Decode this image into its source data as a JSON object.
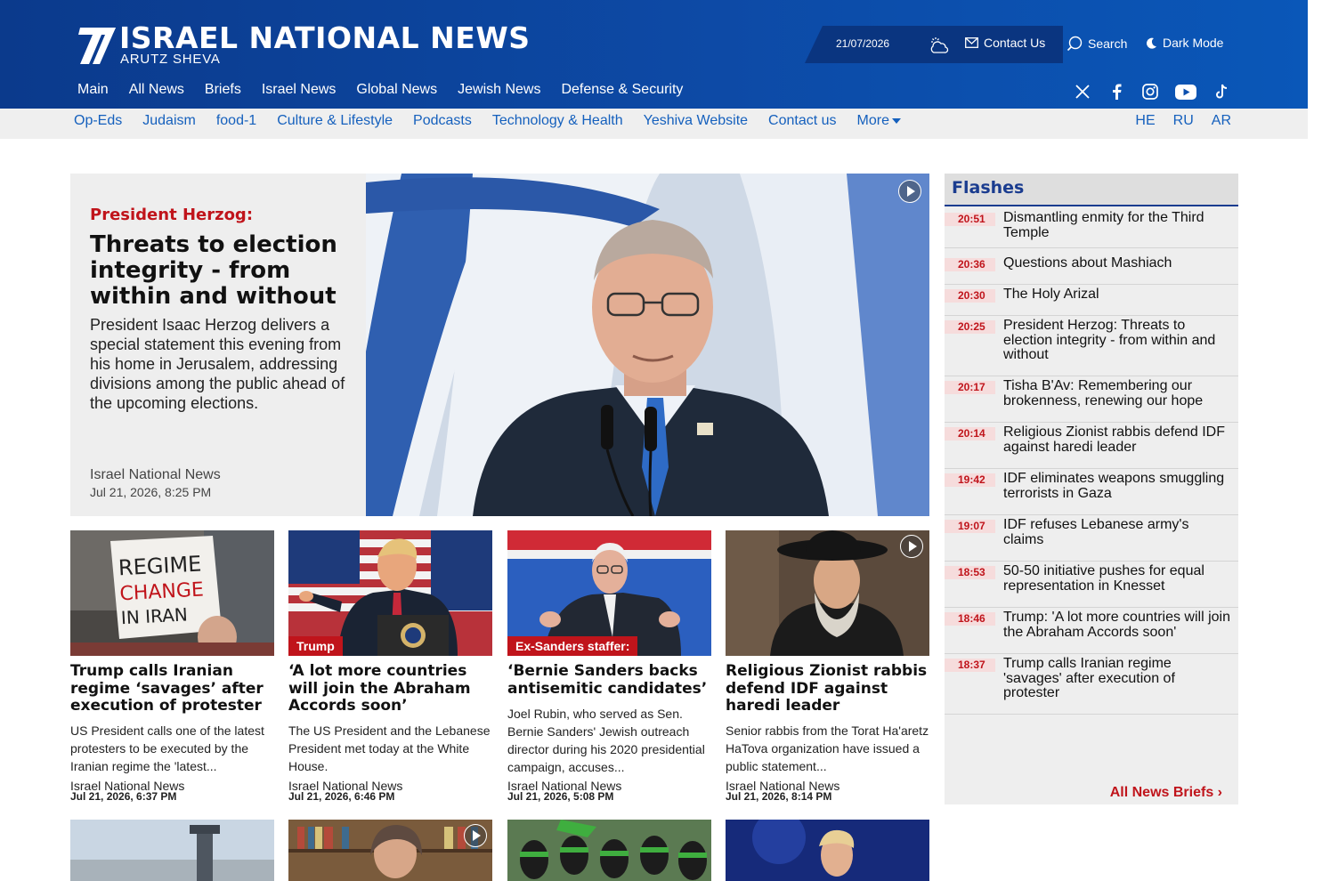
{
  "brand": {
    "title": "ISRAEL NATIONAL NEWS",
    "subtitle": "ARUTZ SHEVA"
  },
  "utility": {
    "date": "21/07/2026",
    "contact": "Contact Us",
    "search": "Search",
    "dark_mode": "Dark Mode"
  },
  "main_nav": [
    "Main",
    "All News",
    "Briefs",
    "Israel News",
    "Global News",
    "Jewish News",
    "Defense & Security"
  ],
  "sub_nav": [
    "Op-Eds",
    "Judaism",
    "food-1",
    "Culture & Lifestyle",
    "Podcasts",
    "Technology & Health",
    "Yeshiva Website",
    "Contact us",
    "More"
  ],
  "languages": [
    "HE",
    "RU",
    "AR"
  ],
  "social_icons": [
    "x-icon",
    "facebook-icon",
    "instagram-icon",
    "youtube-icon",
    "tiktok-icon"
  ],
  "hero": {
    "kicker": "President Herzog:",
    "headline": "Threats to election integrity - from within and without",
    "summary": "President Isaac Herzog delivers a special statement this evening from his home in Jerusalem, addressing divisions among the public ahead of the upcoming elections.",
    "author": "Israel National News",
    "date": "Jul 21, 2026, 8:25 PM"
  },
  "cards": [
    {
      "tag": "",
      "title": "Trump calls Iranian regime ‘savages’ after execution of protester",
      "summary": "US President calls one of the latest protesters to be executed by the Iranian regime the 'latest...",
      "author": "Israel National News",
      "date": "Jul 21, 2026, 6:37 PM"
    },
    {
      "tag": "Trump",
      "title": "‘A lot more countries will join the Abraham Accords soon’",
      "summary": "The US President and the Lebanese President met today at the White House.",
      "author": "Israel National News",
      "date": "Jul 21, 2026, 6:46 PM"
    },
    {
      "tag": "Ex-Sanders staffer:",
      "title": "‘Bernie Sanders backs antisemitic candidates’",
      "summary": "Joel Rubin, who served as Sen. Bernie Sanders' Jewish outreach director during his 2020 presidential campaign, accuses...",
      "author": "Israel National News",
      "date": "Jul 21, 2026, 5:08 PM"
    },
    {
      "tag": "",
      "title": "Religious Zionist rabbis defend IDF against haredi leader",
      "summary": "Senior rabbis from the Torat Ha'aretz HaTova organization have issued a public statement...",
      "author": "Israel National News",
      "date": "Jul 21, 2026, 8:14 PM"
    }
  ],
  "sign_text": {
    "line1": "REGIME",
    "line2": "CHANGE",
    "line3": "IN IRAN"
  },
  "flashes": {
    "title": "Flashes",
    "items": [
      {
        "time": "20:51",
        "text": "Dismantling enmity for the Third Temple"
      },
      {
        "time": "20:36",
        "text": "Questions about Mashiach"
      },
      {
        "time": "20:30",
        "text": "The Holy Arizal"
      },
      {
        "time": "20:25",
        "text": "President Herzog: Threats to election integrity - from within and without"
      },
      {
        "time": "20:17",
        "text": "Tisha B'Av: Remembering our brokenness, renewing our hope"
      },
      {
        "time": "20:14",
        "text": "Religious Zionist rabbis defend IDF against haredi leader"
      },
      {
        "time": "19:42",
        "text": "IDF eliminates weapons smuggling terrorists in Gaza"
      },
      {
        "time": "19:07",
        "text": "IDF refuses Lebanese army's claims"
      },
      {
        "time": "18:53",
        "text": "50-50 initiative pushes for equal representation in Knesset"
      },
      {
        "time": "18:46",
        "text": "Trump: 'A lot more countries will join the Abraham Accords soon'"
      },
      {
        "time": "18:37",
        "text": "Trump calls Iranian regime 'savages' after execution of protester"
      }
    ],
    "all_briefs": "All News Briefs ›"
  },
  "colors": {
    "header_blue": "#0d4aa6",
    "accent_red": "#c0141b",
    "link_blue": "#1560bd",
    "flashes_title": "#1a3c8f"
  }
}
